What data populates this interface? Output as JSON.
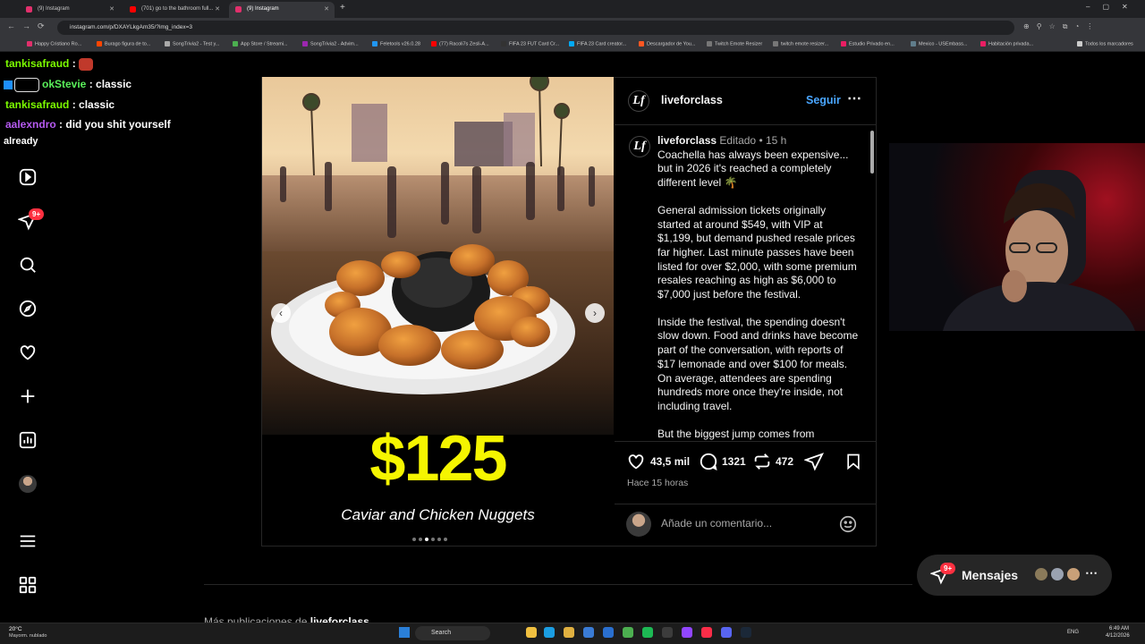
{
  "browser": {
    "tabs": [
      {
        "label": "(9) Instagram",
        "color": "#e1306c"
      },
      {
        "label": "(701) go to the bathroom full...",
        "color": "#ff0000"
      },
      {
        "label": "(9) Instagram",
        "color": "#e1306c"
      }
    ],
    "url": "instagram.com/p/DXAYLkgAm35/?img_index=3",
    "bookmarks": [
      "Happy Cristiano Ro...",
      "Burago figura de to...",
      "SongTrivia2 - Test y...",
      "App Store / Streami...",
      "SongTrivia2 - Advim...",
      "Feletools v26.0.28",
      "(77) Racoli7s Zesli-A...",
      "FIFA 23 FUT Card Cr...",
      "FIFA 23 Card creator...",
      "Descargador de You...",
      "Twitch Emote Resizer",
      "twitch emote resizer...",
      "Estudio Privado en...",
      "Mexico - USEmbass...",
      "Habitación privada...",
      "Todos los marcadores"
    ]
  },
  "chat": [
    {
      "user": "tankisafraud",
      "color": "#7CFC00",
      "message": ""
    },
    {
      "user": "okStevie",
      "color": "#5af05a",
      "message": " classic"
    },
    {
      "user": "tankisafraud",
      "color": "#7CFC00",
      "message": " classic"
    },
    {
      "user": "aalexndro",
      "color": "#b55af0",
      "message": " did you shit yourself"
    },
    {
      "user": "",
      "color": "#ffffff",
      "message": "already"
    }
  ],
  "sidebar": {
    "notification_badge": "9+"
  },
  "post": {
    "author": "liveforclass",
    "avatar_text": "Lf",
    "follow": "Seguir",
    "edited": "Editado",
    "time_ago": "15 h",
    "price": "$125",
    "media_caption": "Caviar and Chicken Nuggets",
    "caption_p1": "Coachella has always been expensive... but in 2026 it's reached a completely different level 🌴",
    "caption_p2": "General admission tickets originally started at around $549, with VIP at $1,199, but demand pushed resale prices far higher. Last minute passes have been listed for over $2,000, with some premium resales reaching as high as $6,000 to $7,000 just before the festival.",
    "caption_p3": "Inside the festival, the spending doesn't slow down. Food and drinks have become part of the conversation, with reports of $17 lemonade and over $100 for meals. On average, attendees are spending hundreds more once they're inside, not including travel.",
    "caption_p4": "But the biggest jump comes from",
    "likes": "43,5 mil",
    "comments": "1321",
    "reposts": "472",
    "posted": "Hace 15 horas",
    "comment_placeholder": "Añade un comentario..."
  },
  "more_posts_label": "Más publicaciones de",
  "messages": {
    "label": "Mensajes",
    "badge": "9+"
  },
  "taskbar": {
    "weather_temp": "20°C",
    "weather_desc": "Mayorm. nublado",
    "search": "Search",
    "lang": "ENG",
    "time": "6:49 AM",
    "date": "4/12/2026"
  }
}
